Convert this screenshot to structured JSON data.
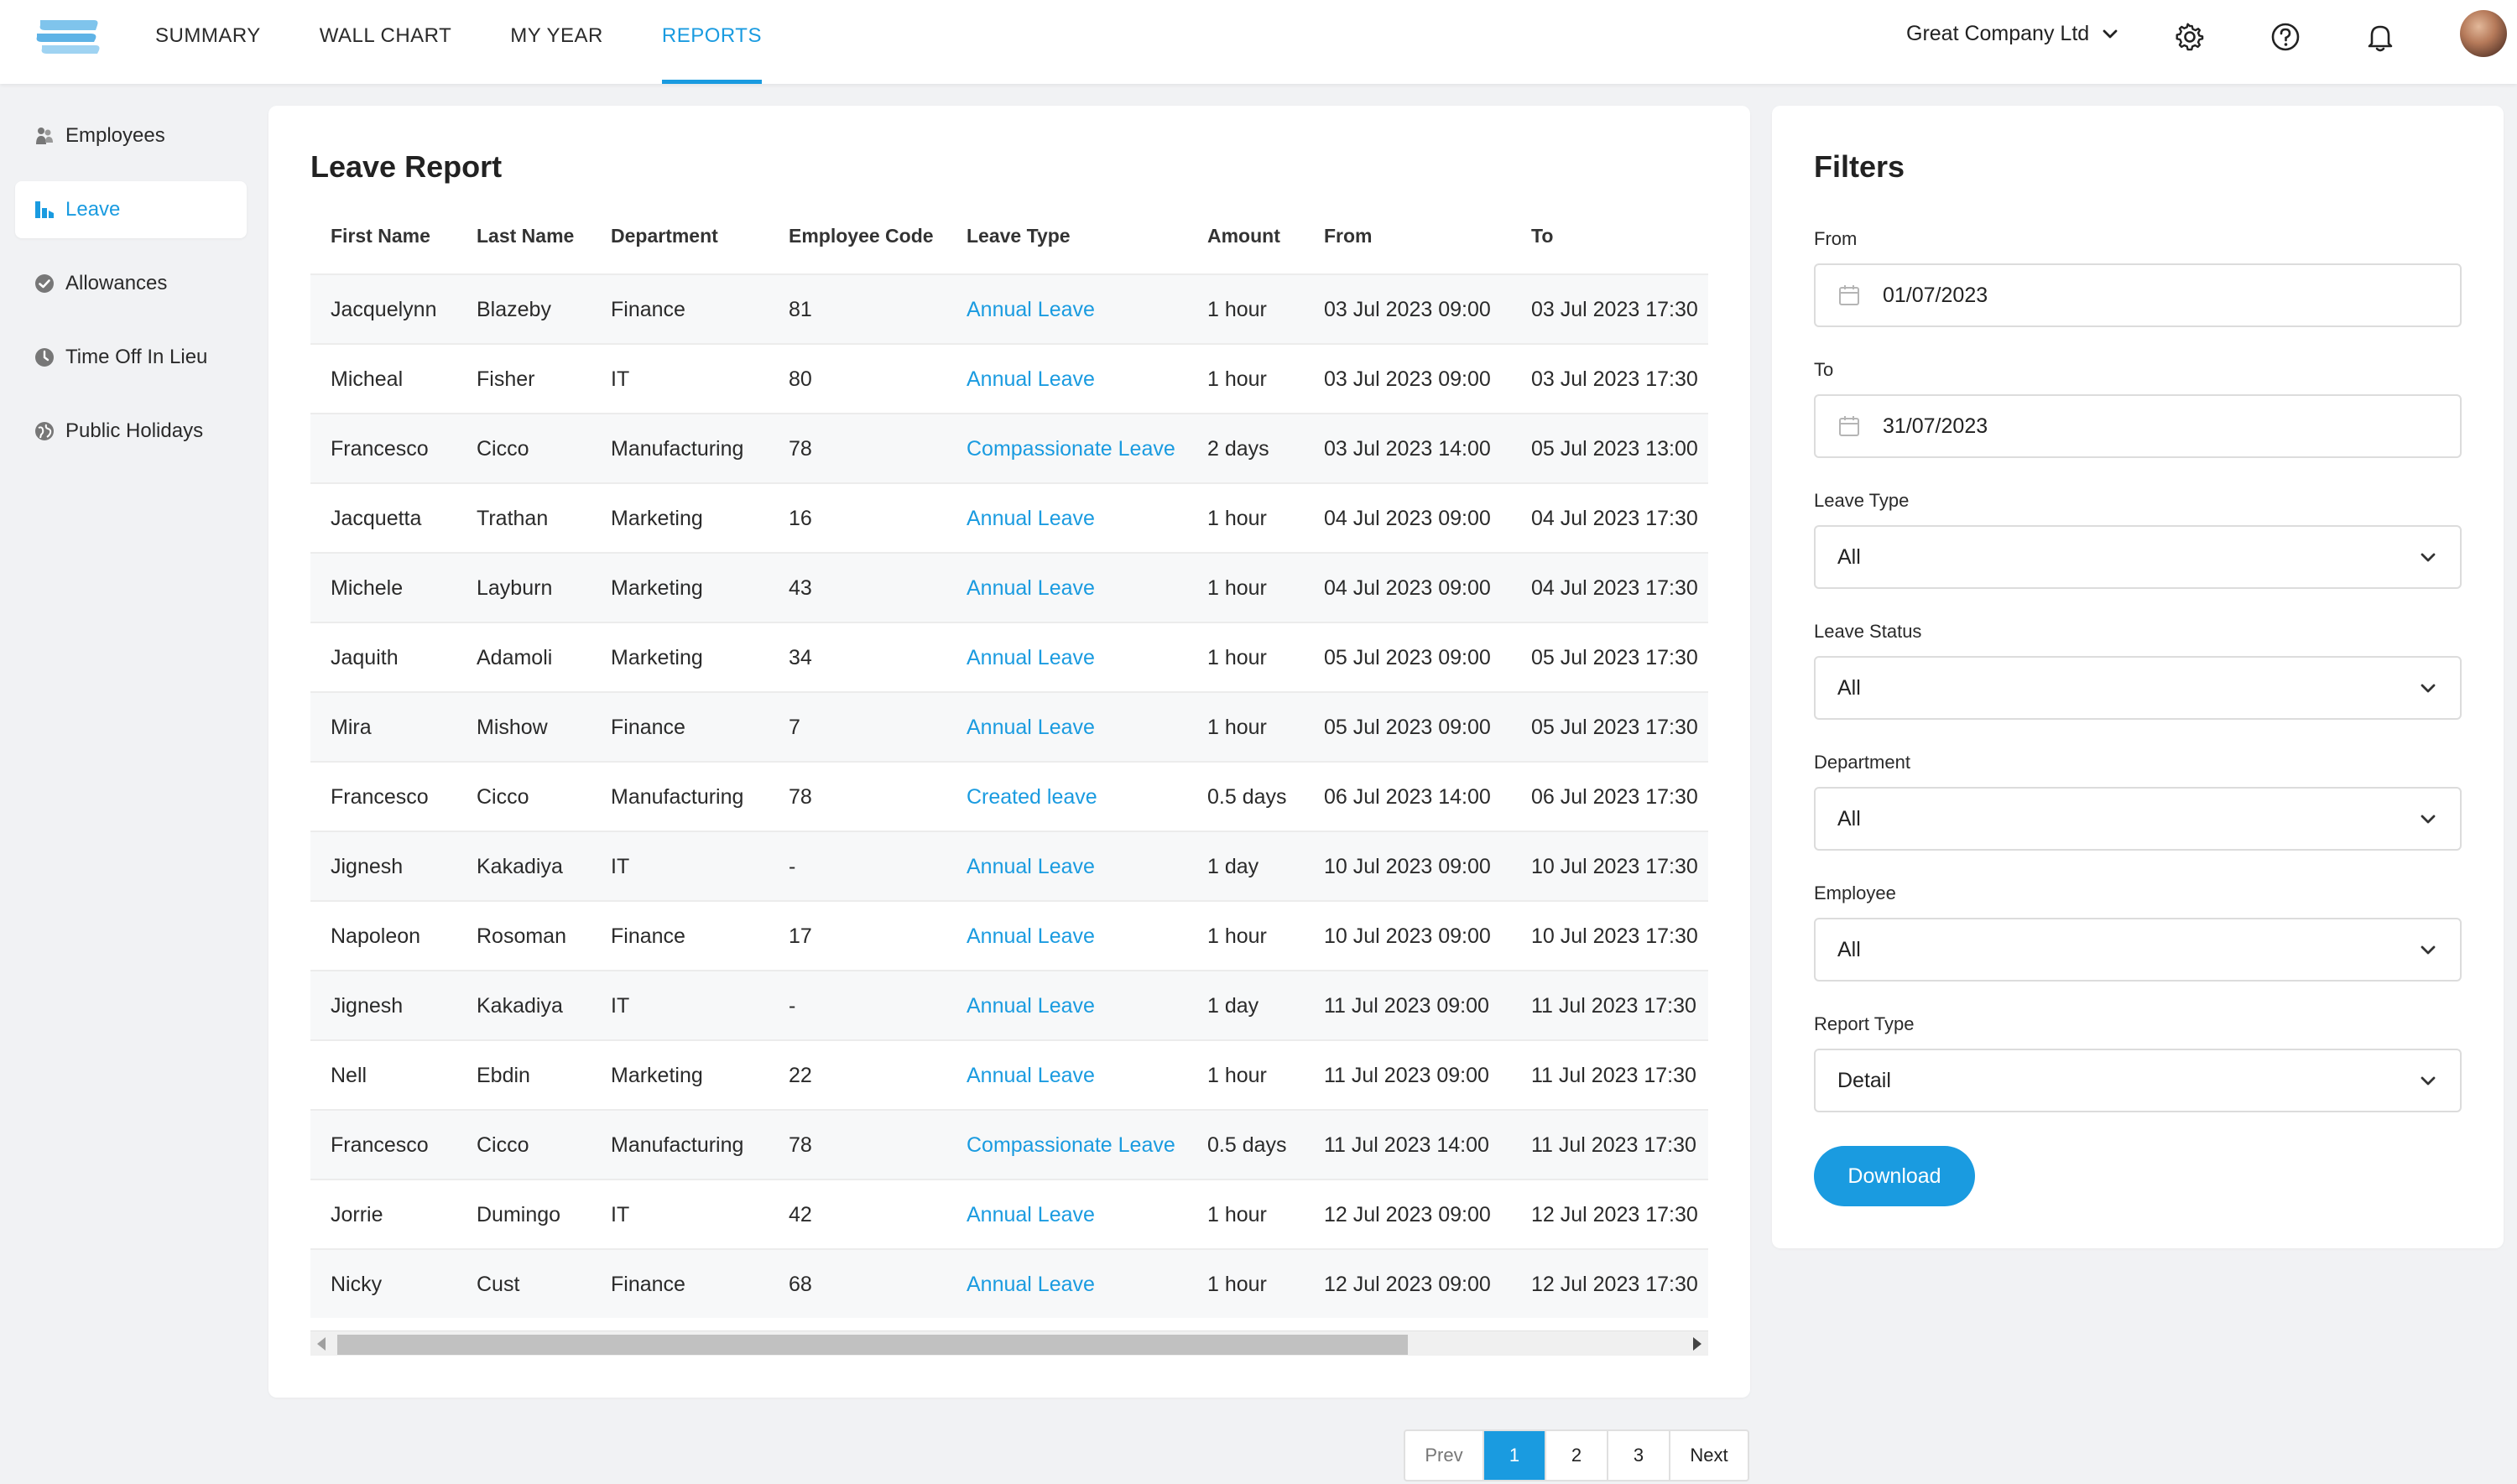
{
  "nav": {
    "items": [
      {
        "label": "SUMMARY",
        "active": false
      },
      {
        "label": "WALL CHART",
        "active": false
      },
      {
        "label": "MY YEAR",
        "active": false
      },
      {
        "label": "REPORTS",
        "active": true
      }
    ],
    "company": "Great Company Ltd"
  },
  "sidebar": {
    "items": [
      {
        "label": "Employees",
        "icon": "people-icon",
        "active": false
      },
      {
        "label": "Leave",
        "icon": "bar-chart-icon",
        "active": true
      },
      {
        "label": "Allowances",
        "icon": "check-circle-icon",
        "active": false
      },
      {
        "label": "Time Off In Lieu",
        "icon": "clock-icon",
        "active": false
      },
      {
        "label": "Public Holidays",
        "icon": "globe-icon",
        "active": false
      }
    ]
  },
  "report": {
    "title": "Leave Report",
    "columns": [
      "First Name",
      "Last Name",
      "Department",
      "Employee Code",
      "Leave Type",
      "Amount",
      "From",
      "To"
    ],
    "rows": [
      [
        "Jacquelynn",
        "Blazeby",
        "Finance",
        "81",
        "Annual Leave",
        "1 hour",
        "03 Jul 2023 09:00",
        "03 Jul 2023 17:30"
      ],
      [
        "Micheal",
        "Fisher",
        "IT",
        "80",
        "Annual Leave",
        "1 hour",
        "03 Jul 2023 09:00",
        "03 Jul 2023 17:30"
      ],
      [
        "Francesco",
        "Cicco",
        "Manufacturing",
        "78",
        "Compassionate Leave",
        "2 days",
        "03 Jul 2023 14:00",
        "05 Jul 2023 13:00"
      ],
      [
        "Jacquetta",
        "Trathan",
        "Marketing",
        "16",
        "Annual Leave",
        "1 hour",
        "04 Jul 2023 09:00",
        "04 Jul 2023 17:30"
      ],
      [
        "Michele",
        "Layburn",
        "Marketing",
        "43",
        "Annual Leave",
        "1 hour",
        "04 Jul 2023 09:00",
        "04 Jul 2023 17:30"
      ],
      [
        "Jaquith",
        "Adamoli",
        "Marketing",
        "34",
        "Annual Leave",
        "1 hour",
        "05 Jul 2023 09:00",
        "05 Jul 2023 17:30"
      ],
      [
        "Mira",
        "Mishow",
        "Finance",
        "7",
        "Annual Leave",
        "1 hour",
        "05 Jul 2023 09:00",
        "05 Jul 2023 17:30"
      ],
      [
        "Francesco",
        "Cicco",
        "Manufacturing",
        "78",
        "Created leave",
        "0.5 days",
        "06 Jul 2023 14:00",
        "06 Jul 2023 17:30"
      ],
      [
        "Jignesh",
        "Kakadiya",
        "IT",
        "-",
        "Annual Leave",
        "1 day",
        "10 Jul 2023 09:00",
        "10 Jul 2023 17:30"
      ],
      [
        "Napoleon",
        "Rosoman",
        "Finance",
        "17",
        "Annual Leave",
        "1 hour",
        "10 Jul 2023 09:00",
        "10 Jul 2023 17:30"
      ],
      [
        "Jignesh",
        "Kakadiya",
        "IT",
        "-",
        "Annual Leave",
        "1 day",
        "11 Jul 2023 09:00",
        "11 Jul 2023 17:30"
      ],
      [
        "Nell",
        "Ebdin",
        "Marketing",
        "22",
        "Annual Leave",
        "1 hour",
        "11 Jul 2023 09:00",
        "11 Jul 2023 17:30"
      ],
      [
        "Francesco",
        "Cicco",
        "Manufacturing",
        "78",
        "Compassionate Leave",
        "0.5 days",
        "11 Jul 2023 14:00",
        "11 Jul 2023 17:30"
      ],
      [
        "Jorrie",
        "Dumingo",
        "IT",
        "42",
        "Annual Leave",
        "1 hour",
        "12 Jul 2023 09:00",
        "12 Jul 2023 17:30"
      ],
      [
        "Nicky",
        "Cust",
        "Finance",
        "68",
        "Annual Leave",
        "1 hour",
        "12 Jul 2023 09:00",
        "12 Jul 2023 17:30"
      ]
    ]
  },
  "filters": {
    "title": "Filters",
    "from_label": "From",
    "from_value": "01/07/2023",
    "to_label": "To",
    "to_value": "31/07/2023",
    "leave_type_label": "Leave Type",
    "leave_type_value": "All",
    "leave_status_label": "Leave Status",
    "leave_status_value": "All",
    "department_label": "Department",
    "department_value": "All",
    "employee_label": "Employee",
    "employee_value": "All",
    "report_type_label": "Report Type",
    "report_type_value": "Detail",
    "download_label": "Download"
  },
  "pagination": {
    "prev": "Prev",
    "pages": [
      "1",
      "2",
      "3"
    ],
    "current": "1",
    "next": "Next"
  },
  "colors": {
    "accent": "#1a9be0",
    "background": "#f1f2f4",
    "row_stripe": "#f7f8f9"
  }
}
